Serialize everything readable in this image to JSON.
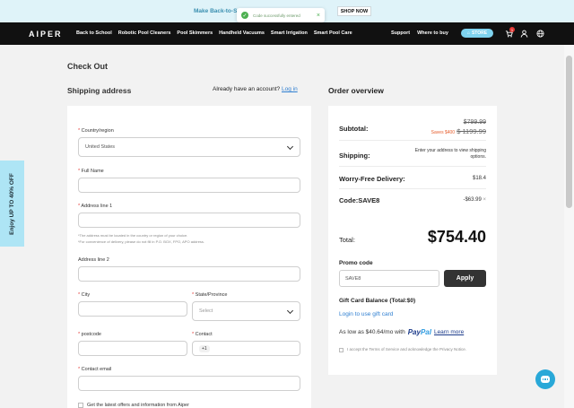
{
  "promo": {
    "text": "Make Back-to-S",
    "shop_now": "SHOP NOW"
  },
  "toast": {
    "message": "Code successfully entered"
  },
  "nav": {
    "logo": "AIPER",
    "links": [
      "Back to School",
      "Robotic Pool Cleaners",
      "Pool Skimmers",
      "Handheld Vacuums",
      "Smart Irrigation",
      "Smart Pool Care"
    ],
    "right_links": [
      "Support",
      "Where to buy"
    ],
    "store_label": "STORE",
    "cart_count": "1"
  },
  "page": {
    "title": "Check Out",
    "shipping_heading": "Shipping address",
    "account_prompt": "Already have an account?",
    "login_link": "Log in",
    "overview_heading": "Order overview"
  },
  "form": {
    "country_label": "Country/region",
    "country_value": "United States",
    "full_name_label": "Full Name",
    "address1_label": "Address line 1",
    "hint1": "*The address must be located in the country or region of your choice.",
    "hint2": "*For convenience of delivery, please do not fill in P.O. BOX, FPO, APO address.",
    "address2_label": "Address line 2",
    "city_label": "City",
    "state_label": "State/Province",
    "state_placeholder": "Select",
    "postcode_label": "postcode",
    "contact_label": "Contact",
    "contact_prefix": "+1",
    "email_label": "Contact email",
    "offers_label": "Get the latest offers and information from Aiper"
  },
  "order": {
    "subtotal_label": "Subtotal:",
    "subtotal_original": "$799.99",
    "saves": "Saves $400",
    "subtotal_strike": "$ 1199.99",
    "shipping_label": "Shipping:",
    "shipping_value": "Enter your address to view shipping options.",
    "worry_label": "Worry-Free Delivery:",
    "worry_value": "$18.4",
    "code_label": "Code:SAVE8",
    "code_value": "-$63.99",
    "total_label": "Total:",
    "total_value": "$754.40",
    "promo_label": "Promo code",
    "promo_value": "SAVE8",
    "apply_label": "Apply",
    "gift_label": "Gift Card Balance (Total:$0)",
    "gift_link": "Login to use gift card",
    "paypal_prefix": "As low as $40.64/mo with",
    "paypal_brand_a": "Pay",
    "paypal_brand_b": "Pal",
    "learn_more": "Learn more",
    "terms": "I accept the Terms of Service and acknowledge the Privacy Notice."
  },
  "side_tab": {
    "text": "Enjoy UP TO 40% OFF"
  },
  "colors": {
    "accent": "#2f7fd1",
    "side_tab": "#aee5f5",
    "nav_bg": "#111111",
    "store": "#7fd3ef"
  }
}
